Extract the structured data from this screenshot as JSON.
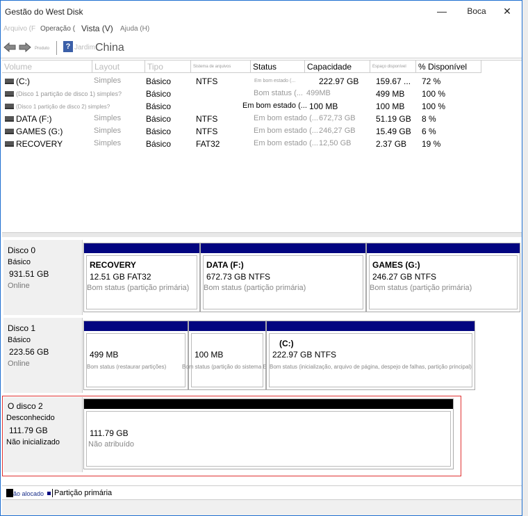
{
  "window": {
    "title": "Gestão do West Disk",
    "help_button": "Boca",
    "close_glyph": "✕",
    "minimize_glyph": "—"
  },
  "menu": [
    "Arquivo (F",
    "Operação (",
    "Vista (V)",
    "Ajuda (H)"
  ],
  "toolbar": {
    "small_label": "Produto",
    "help_glyph": "?",
    "faint_label": "Jardim",
    "location": "China"
  },
  "columns": [
    "Volume",
    "Layout",
    "Tipo",
    "Sistema de arquivos",
    "Status",
    "Capacidade",
    "Espaço disponível",
    "% Disponível"
  ],
  "volumes": [
    {
      "name": " (C:)",
      "layout": "Simples",
      "type": "Básico",
      "fs": "NTFS",
      "status": "Em bom estado (...",
      "capacity": "222.97 GB",
      "free": "159.67 ...",
      "pct": "72 %"
    },
    {
      "name": "(Disco 1 partição de disco 1) simples?",
      "layout": "",
      "type": "Básico",
      "fs": "",
      "status": "Bom status (...",
      "capacity": "499MB",
      "free": "499 MB",
      "pct": "100 %"
    },
    {
      "name": "(Disco 1 partição de disco 2) simples?",
      "layout": "",
      "type": "Básico",
      "fs": "",
      "status": "Em bom estado (...",
      "capacity": "100 MB",
      "free": "100 MB",
      "pct": "100 %"
    },
    {
      "name": "DATA (F:)",
      "layout": "Simples",
      "type": "Básico",
      "fs": "NTFS",
      "status": "Em bom estado (...",
      "capacity": "672,73 GB",
      "free": "51.19 GB",
      "pct": "8 %"
    },
    {
      "name": "GAMES (G:)",
      "layout": "Simples",
      "type": "Básico",
      "fs": "NTFS",
      "status": "Em bom estado (...",
      "capacity": "246,27 GB",
      "free": "15.49 GB",
      "pct": "6 %"
    },
    {
      "name": "RECOVERY",
      "layout": "Simples",
      "type": "Básico",
      "fs": "FAT32",
      "status": "Em bom estado (...",
      "capacity": "12,50 GB",
      "free": "2.37 GB",
      "pct": "19 %"
    }
  ],
  "disks": [
    {
      "name": "Disco 0",
      "type": "Básico",
      "size": "931.51 GB",
      "state": "Online",
      "partitions": [
        {
          "title": "RECOVERY",
          "size": "12.51 GB FAT32",
          "status": "Bom status (partição primária)"
        },
        {
          "title": "DATA  (F:)",
          "size": "672.73 GB NTFS",
          "status": "Bom status (partição primária)"
        },
        {
          "title": "GAMES  (G:)",
          "size": "246.27 GB NTFS",
          "status": "Bom status (partição primária)"
        }
      ]
    },
    {
      "name": "Disco 1",
      "type": "Básico",
      "size": "223.56 GB",
      "state": "Online",
      "partitions": [
        {
          "title": "",
          "size": "499 MB",
          "status": "Bom status (restaurar partições)"
        },
        {
          "title": "",
          "size": "100 MB",
          "status": "Bom status (partição do sistema EFI)"
        },
        {
          "title": "(C:)",
          "size": "222.97 GB NTFS",
          "status": "Bom status (inicialização, arquivo de página, despejo de falhas, partição principal)"
        }
      ]
    },
    {
      "name": "O disco 2",
      "type": "Desconhecido",
      "size": "111.79 GB",
      "state": "Não inicializado",
      "partitions": [
        {
          "title": "",
          "size": "111.79 GB",
          "status": "Não atribuído"
        }
      ]
    }
  ],
  "legend": {
    "unallocated": "ão alocado",
    "primary": "Partição primária",
    "unallocated_color": "#000000",
    "primary_color": "#020580"
  },
  "colors": {
    "partition_bar": "#020580",
    "unallocated_bar": "#000000",
    "highlight_border": "#e03030"
  }
}
